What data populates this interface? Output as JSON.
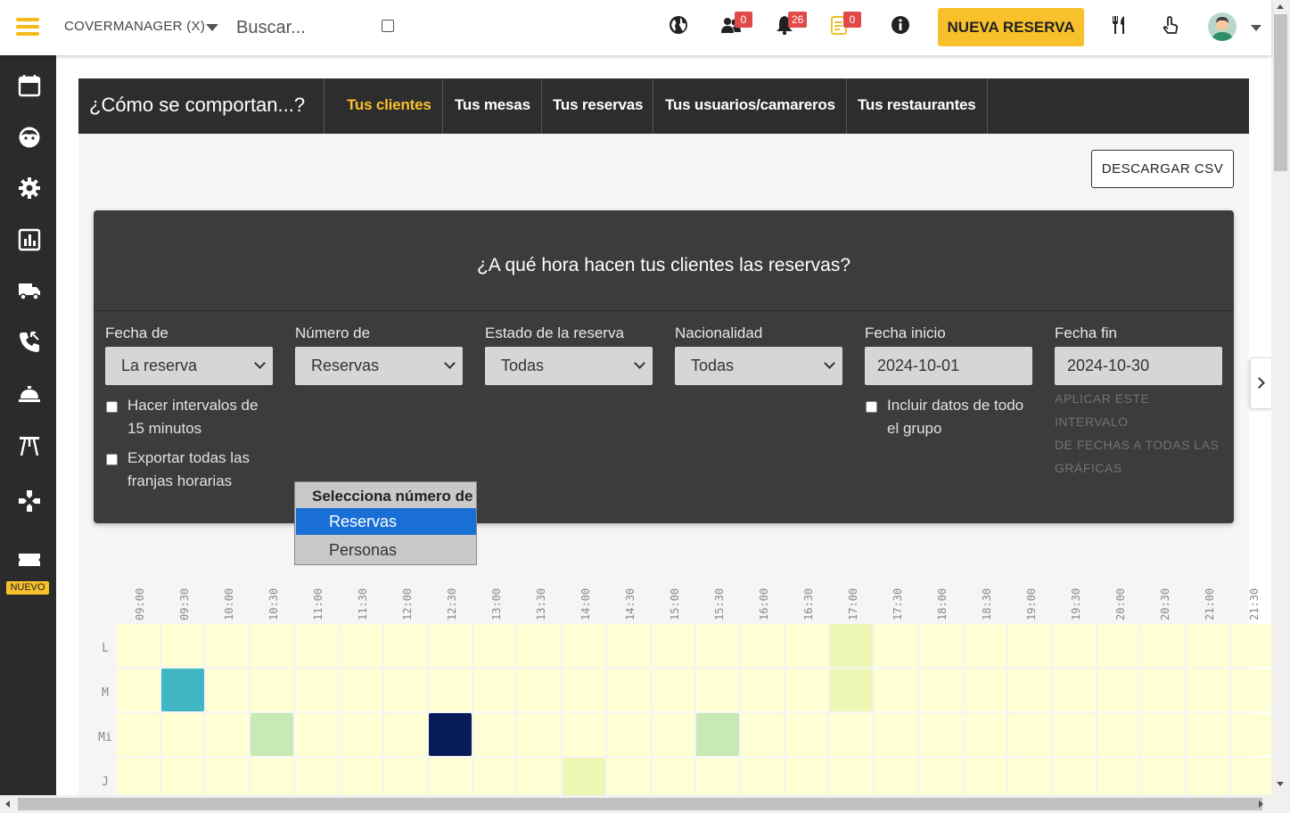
{
  "header": {
    "restaurant": "COVERMANAGER (X)",
    "search_placeholder": "Buscar...",
    "badges": {
      "team": "0",
      "alerts": "26",
      "notes": "0"
    },
    "new_booking_label": "NUEVA RESERVA",
    "accent": "#f8c12b"
  },
  "sidebar": {
    "items": [
      "calendar-icon",
      "face-icon",
      "gear-icon",
      "chart-icon",
      "truck-icon",
      "phone-icon",
      "service-bell-icon",
      "gate-icon",
      "gamepad-icon",
      "ticket-icon"
    ],
    "nuevo_label": "NUEVO"
  },
  "tabs": {
    "title": "¿Cómo se comportan...?",
    "items": [
      {
        "label": "Tus clientes",
        "active": true
      },
      {
        "label": "Tus mesas",
        "active": false
      },
      {
        "label": "Tus reservas",
        "active": false
      },
      {
        "label": "Tus usuarios/camareros",
        "active": false
      },
      {
        "label": "Tus restaurantes",
        "active": false
      }
    ]
  },
  "toolbar": {
    "csv_label": "DESCARGAR CSV"
  },
  "panel": {
    "title": "¿A qué hora hacen tus clientes las reservas?",
    "filters": {
      "fecha_de": {
        "label": "Fecha de",
        "value": "La reserva"
      },
      "numero_de": {
        "label": "Número de",
        "value": "Reservas"
      },
      "estado": {
        "label": "Estado de la reserva",
        "value": "Todas"
      },
      "nacionalidad": {
        "label": "Nacionalidad",
        "value": "Todas"
      },
      "fecha_inicio": {
        "label": "Fecha inicio",
        "value": "2024-10-01"
      },
      "fecha_fin": {
        "label": "Fecha fin",
        "value": "2024-10-30"
      }
    },
    "checkboxes": {
      "intervals_l1": "Hacer intervalos de",
      "intervals_l2": "15 minutos",
      "export_l1": "Exportar todas las",
      "export_l2": "franjas horarias",
      "group_l1": "Incluir datos de todo",
      "group_l2": "el grupo"
    },
    "apply_l1": "APLICAR ESTE INTERVALO",
    "apply_l2": "DE FECHAS A TODAS LAS",
    "apply_l3": "GRÁFICAS"
  },
  "dropdown": {
    "header": "Selecciona número de",
    "options": [
      "Reservas",
      "Personas"
    ],
    "selected": "Reservas"
  },
  "chart_data": {
    "type": "heatmap",
    "x": [
      "09:00",
      "09:30",
      "10:00",
      "10:30",
      "11:00",
      "11:30",
      "12:00",
      "12:30",
      "13:00",
      "13:30",
      "14:00",
      "14:30",
      "15:00",
      "15:30",
      "16:00",
      "16:30",
      "17:00",
      "17:30",
      "18:00",
      "18:30",
      "19:00",
      "19:30",
      "20:00",
      "20:30",
      "21:00",
      "21:30"
    ],
    "y": [
      "L",
      "M",
      "Mi",
      "J"
    ],
    "values": [
      [
        0,
        0,
        0,
        0,
        0,
        0,
        0,
        0,
        0,
        0,
        0,
        0,
        0,
        0,
        0,
        0,
        1,
        0,
        0,
        0,
        0,
        0,
        0,
        0,
        0,
        0
      ],
      [
        0,
        3,
        0,
        0,
        0,
        0,
        0,
        0,
        0,
        0,
        0,
        0,
        0,
        0,
        0,
        0,
        1,
        0,
        0,
        0,
        0,
        0,
        0,
        0,
        0,
        0
      ],
      [
        0,
        0,
        0,
        2,
        0,
        0,
        0,
        5,
        0,
        0,
        0,
        0,
        0,
        2,
        0,
        0,
        0,
        0,
        0,
        0,
        0,
        0,
        0,
        0,
        0,
        0
      ],
      [
        0,
        0,
        0,
        0,
        0,
        0,
        0,
        0,
        0,
        0,
        1,
        0,
        0,
        0,
        0,
        0,
        0,
        0,
        0,
        0,
        0,
        0,
        0,
        0,
        0,
        0
      ]
    ],
    "colors": [
      "#ffffd4",
      "#edf7b3",
      "#c8e8b4",
      "#41b6c4",
      "#225ea8",
      "#081d58"
    ]
  }
}
